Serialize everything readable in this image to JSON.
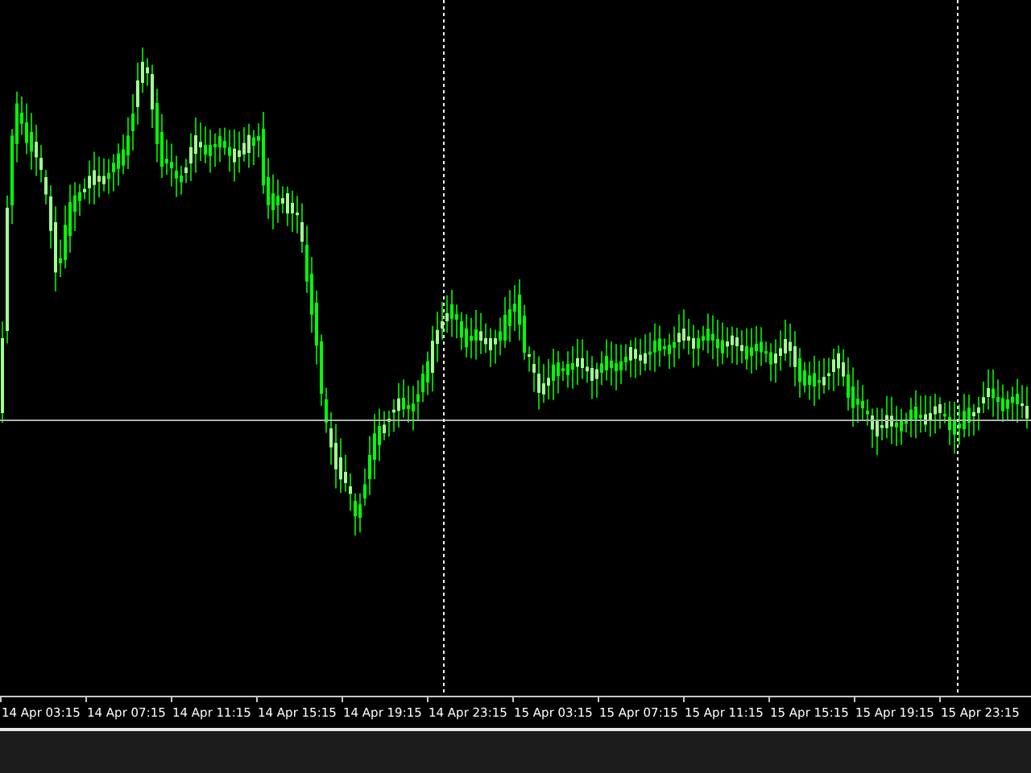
{
  "chart": {
    "time_axis": {
      "labels": [
        "14 Apr 03:15",
        "14 Apr 07:15",
        "14 Apr 11:15",
        "14 Apr 15:15",
        "14 Apr 19:15",
        "14 Apr 23:15",
        "15 Apr 03:15",
        "15 Apr 07:15",
        "15 Apr 11:15",
        "15 Apr 15:15",
        "15 Apr 19:15",
        "15 Apr 23:15"
      ]
    }
  }
}
